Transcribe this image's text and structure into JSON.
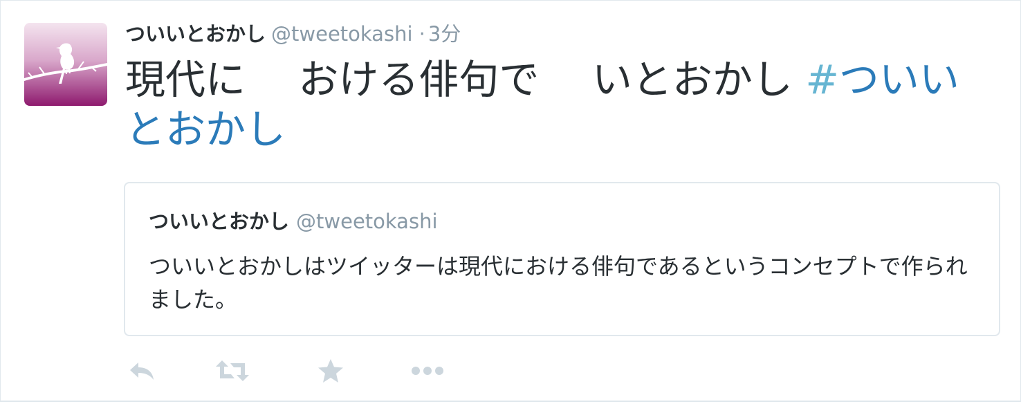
{
  "tweet": {
    "fullname": "ついいとおかし",
    "screen_name": "@tweetokashi",
    "separator": "·",
    "timestamp": "3分",
    "text": "現代に　 おける俳句で　 いとおかし ",
    "hash_symbol": "#",
    "hashtag": "ついいとおかし",
    "colors": {
      "text": "#292f33",
      "secondary": "#8899a6",
      "link": "#2b7bb9",
      "border": "#e1e8ed",
      "icon": "#ccd6dd"
    }
  },
  "quote": {
    "fullname": "ついいとおかし",
    "screen_name": "@tweetokashi",
    "text": "ついいとおかしはツイッターは現代における俳句であるというコンセプトで作られました。"
  },
  "actions": [
    {
      "name": "reply-icon"
    },
    {
      "name": "retweet-icon"
    },
    {
      "name": "favorite-icon"
    },
    {
      "name": "more-icon"
    }
  ]
}
